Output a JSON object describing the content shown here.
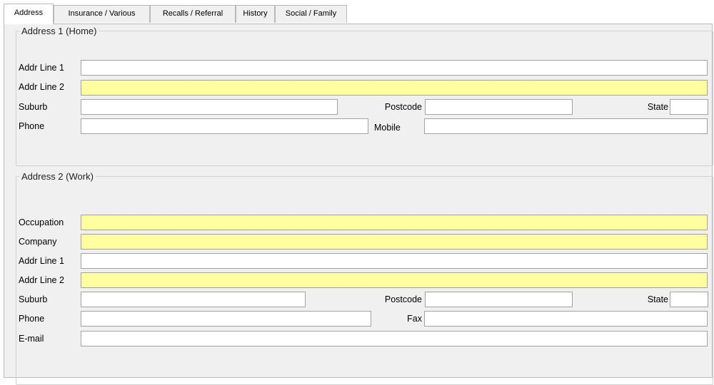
{
  "tabs": [
    {
      "label": "Address",
      "active": true
    },
    {
      "label": "Insurance / Various",
      "active": false
    },
    {
      "label": "Recalls / Referral",
      "active": false
    },
    {
      "label": "History",
      "active": false
    },
    {
      "label": "Social / Family",
      "active": false
    }
  ],
  "colors": {
    "required_field": "#ffffa0",
    "panel_background": "#f0f0f0",
    "field_border": "#a3a3a3"
  },
  "home": {
    "title": "Address 1 (Home)",
    "addr1_label": "Addr Line 1",
    "addr1_value": "",
    "addr2_label": "Addr Line 2",
    "addr2_value": "",
    "suburb_label": "Suburb",
    "suburb_value": "",
    "postcode_label": "Postcode",
    "postcode_value": "",
    "state_label": "State",
    "state_value": "",
    "phone_label": "Phone",
    "phone_value": "",
    "mobile_label": "Mobile",
    "mobile_value": ""
  },
  "work": {
    "title": "Address 2 (Work)",
    "occupation_label": "Occupation",
    "occupation_value": "",
    "company_label": "Company",
    "company_value": "",
    "addr1_label": "Addr Line 1",
    "addr1_value": "",
    "addr2_label": "Addr Line 2",
    "addr2_value": "",
    "suburb_label": "Suburb",
    "suburb_value": "",
    "postcode_label": "Postcode",
    "postcode_value": "",
    "state_label": "State",
    "state_value": "",
    "phone_label": "Phone",
    "phone_value": "",
    "fax_label": "Fax",
    "fax_value": "",
    "email_label": "E-mail",
    "email_value": ""
  }
}
